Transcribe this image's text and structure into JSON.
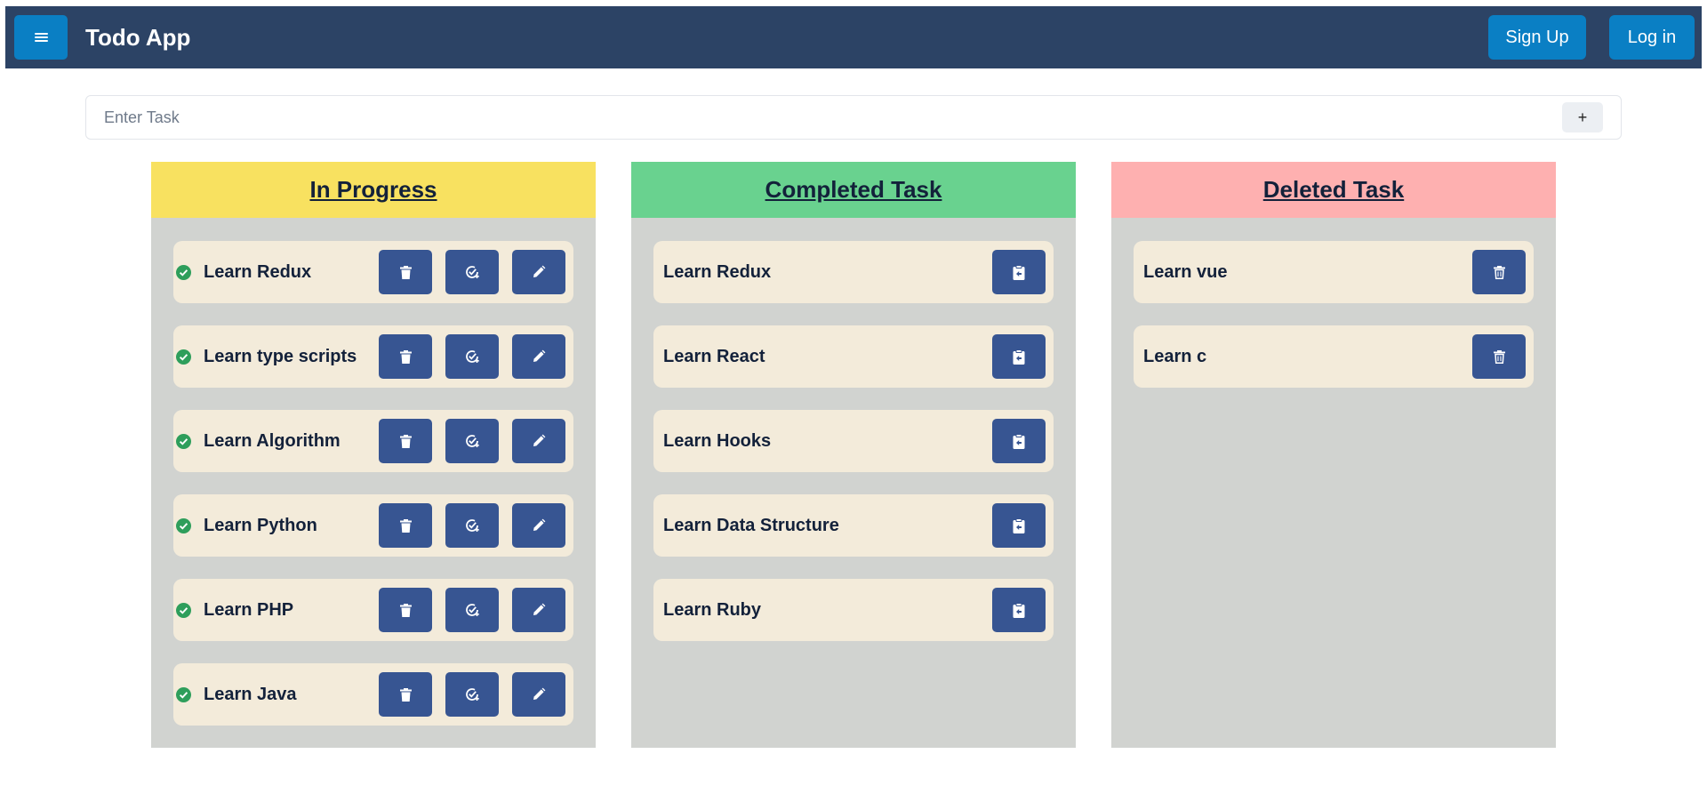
{
  "app": {
    "title": "Todo App",
    "signup_label": "Sign Up",
    "login_label": "Log in"
  },
  "task_input": {
    "placeholder": "Enter Task",
    "add_label": "+"
  },
  "columns": {
    "in_progress": {
      "title": "In Progress",
      "color": "#f8e160",
      "tasks": [
        "Learn Redux",
        "Learn type scripts",
        "Learn Algorithm",
        "Learn Python",
        "Learn PHP",
        "Learn Java"
      ]
    },
    "completed": {
      "title": "Completed Task",
      "color": "#69d28f",
      "tasks": [
        "Learn Redux",
        "Learn React",
        "Learn Hooks",
        "Learn Data Structure",
        "Learn Ruby"
      ]
    },
    "deleted": {
      "title": "Deleted Task",
      "color": "#feb0b0",
      "tasks": [
        "Learn vue",
        "Learn c"
      ]
    }
  },
  "icons": {
    "in_progress_actions": [
      "trash-icon",
      "check-circle-icon",
      "pencil-icon"
    ],
    "completed_action": "clipboard-restore-icon",
    "deleted_action": "trash-outline-icon",
    "status": "check-circle-filled-icon"
  }
}
